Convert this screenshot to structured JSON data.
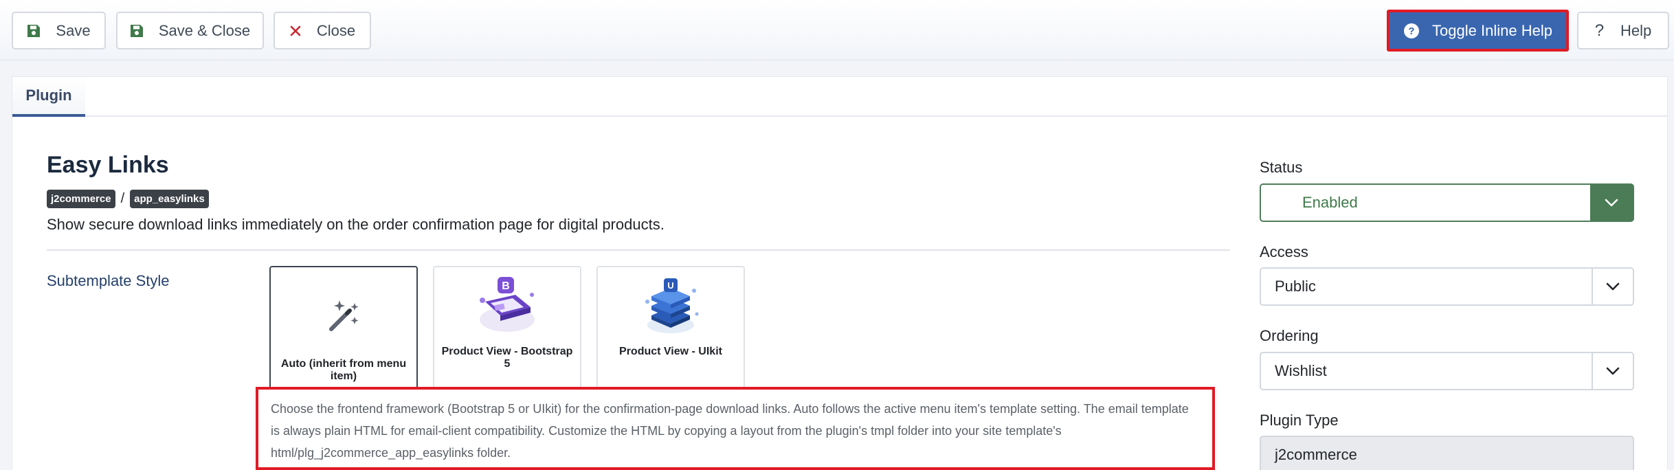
{
  "toolbar": {
    "save_label": "Save",
    "save_close_label": "Save & Close",
    "close_label": "Close",
    "toggle_help_label": "Toggle Inline Help",
    "help_label": "Help"
  },
  "tabs": [
    {
      "label": "Plugin",
      "active": true
    }
  ],
  "plugin": {
    "title": "Easy Links",
    "group_badge": "j2commerce",
    "element_badge": "app_easylinks",
    "separator": "/",
    "description": "Show secure download links immediately on the order confirmation page for digital products."
  },
  "subtemplate": {
    "label": "Subtemplate Style",
    "options": [
      {
        "label": "Auto (inherit from menu item)",
        "icon": "magic-wand-icon",
        "selected": true
      },
      {
        "label": "Product View - Bootstrap 5",
        "icon": "bootstrap-icon",
        "selected": false
      },
      {
        "label": "Product View - UIkit",
        "icon": "uikit-icon",
        "selected": false
      }
    ],
    "help": "Choose the frontend framework (Bootstrap 5 or UIkit) for the confirmation-page download links. Auto follows the active menu item's template setting. The email template is always plain HTML for email-client compatibility. Customize the HTML by copying a layout from the plugin's tmpl folder into your site template's html/plg_j2commerce_app_easylinks folder."
  },
  "sidebar": {
    "status": {
      "label": "Status",
      "value": "Enabled"
    },
    "access": {
      "label": "Access",
      "value": "Public"
    },
    "ordering": {
      "label": "Ordering",
      "value": "Wishlist"
    },
    "plugin_type": {
      "label": "Plugin Type",
      "value": "j2commerce"
    }
  },
  "colors": {
    "accent": "#3a66b0",
    "status_green": "#4b7c55",
    "highlight": "#e01b24"
  }
}
